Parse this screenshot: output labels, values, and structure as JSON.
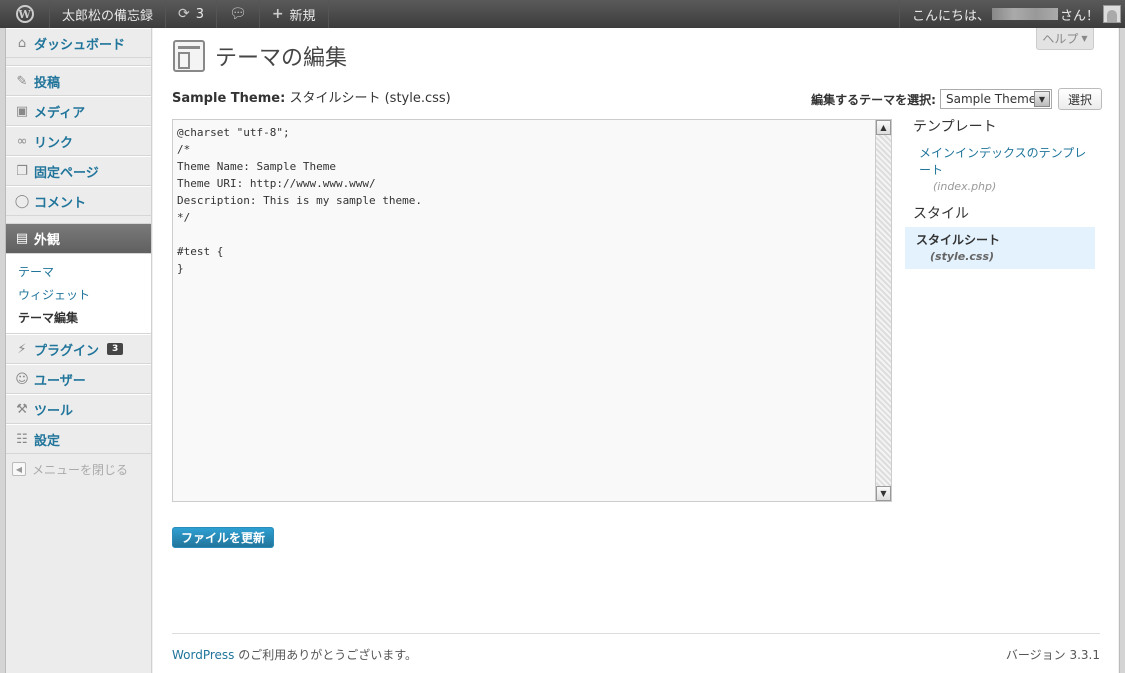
{
  "adminbar": {
    "site_name": "太郎松の備忘録",
    "updates_count": "3",
    "new_label": "新規",
    "greeting_prefix": "こんにちは、",
    "greeting_suffix": "さん！"
  },
  "sidebar": {
    "dashboard": "ダッシュボード",
    "posts": "投稿",
    "media": "メディア",
    "links": "リンク",
    "pages": "固定ページ",
    "comments": "コメント",
    "appearance": "外観",
    "submenu": [
      "テーマ",
      "ウィジェット",
      "テーマ編集"
    ],
    "plugins": "プラグイン",
    "plugins_badge": "3",
    "users": "ユーザー",
    "tools": "ツール",
    "settings": "設定",
    "collapse": "メニューを閉じる"
  },
  "main": {
    "help": "ヘルプ",
    "title": "テーマの編集",
    "theme_name": "Sample Theme:",
    "file_label": "スタイルシート",
    "file_name": "(style.css)",
    "select_label": "編集するテーマを選択:",
    "select_value": "Sample Theme",
    "select_button": "選択",
    "code": "@charset \"utf-8\";\n/*\nTheme Name: Sample Theme\nTheme URI: http://www.www.www/\nDescription: This is my sample theme.\n*/\n\n#test {\n}",
    "update_button": "ファイルを更新"
  },
  "files_panel": {
    "templates_heading": "テンプレート",
    "template_title": "メインインデックスのテンプレート",
    "template_file": "(index.php)",
    "styles_heading": "スタイル",
    "style_title": "スタイルシート",
    "style_file": "(style.css)"
  },
  "footer": {
    "wp_link": "WordPress",
    "thanks": " のご利用ありがとうございます。",
    "version": "バージョン 3.3.1"
  },
  "colors": {
    "link": "#21759b",
    "adminbar": "#464646",
    "active_menu": "#6d6d6d",
    "primary_button": "#21759b"
  }
}
